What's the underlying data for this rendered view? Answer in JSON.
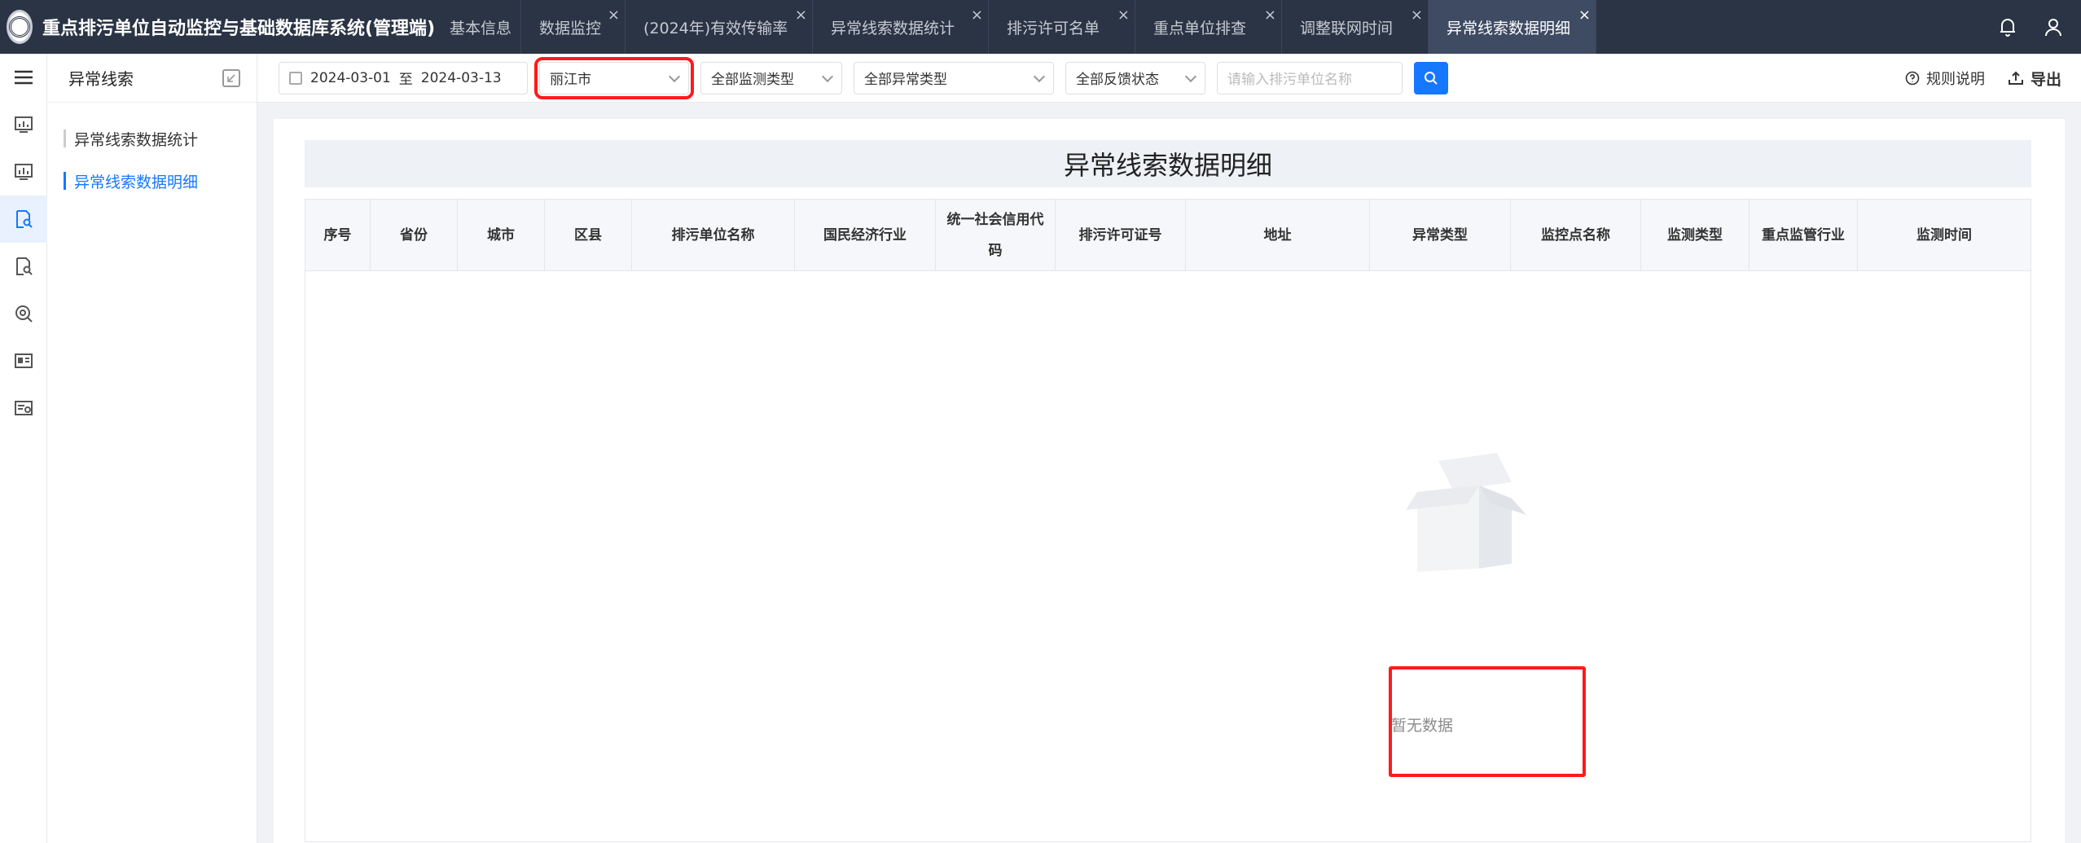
{
  "app": {
    "title": "重点排污单位自动监控与基础数据库系统(管理端)"
  },
  "tabs": [
    {
      "label": "基本信息",
      "closable": false,
      "active": false
    },
    {
      "label": "数据监控",
      "closable": true,
      "active": false
    },
    {
      "label": "(2024年)有效传输率",
      "closable": true,
      "active": false
    },
    {
      "label": "异常线索数据统计",
      "closable": true,
      "active": false
    },
    {
      "label": "排污许可名单",
      "closable": true,
      "active": false
    },
    {
      "label": "重点单位排查",
      "closable": true,
      "active": false
    },
    {
      "label": "调整联网时间",
      "closable": true,
      "active": false
    },
    {
      "label": "异常线索数据明细",
      "closable": true,
      "active": true
    }
  ],
  "tab_close_glyph": "×",
  "header_icons": [
    "bell-icon",
    "user-icon"
  ],
  "rail_icons": [
    "menu-icon",
    "chart-icon",
    "chart-icon-2",
    "document-search-icon",
    "document-search-icon-2",
    "gear-search-icon",
    "id-card-icon",
    "list-settings-icon"
  ],
  "sidebar": {
    "title": "异常线索",
    "items": [
      {
        "label": "异常线索数据统计",
        "active": false
      },
      {
        "label": "异常线索数据明细",
        "active": true
      }
    ]
  },
  "filters": {
    "date_start": "2024-03-01",
    "date_sep": "至",
    "date_end": "2024-03-13",
    "city": "丽江市",
    "monitor_type": "全部监测类型",
    "anomaly_type": "全部异常类型",
    "feedback_status": "全部反馈状态",
    "unit_name_placeholder": "请输入排污单位名称",
    "rules_label": "规则说明",
    "export_label": "导出"
  },
  "table": {
    "title": "异常线索数据明细",
    "columns": [
      "序号",
      "省份",
      "城市",
      "区县",
      "排污单位名称",
      "国民经济行业",
      "统一社会信用代码",
      "排污许可证号",
      "地址",
      "异常类型",
      "监控点名称",
      "监测类型",
      "重点监管行业",
      "监测时间"
    ],
    "rows": [],
    "empty_text": "暂无数据"
  },
  "colors": {
    "topbar": "#2b3445",
    "accent": "#1677ff",
    "highlight": "#ff1a1a"
  }
}
